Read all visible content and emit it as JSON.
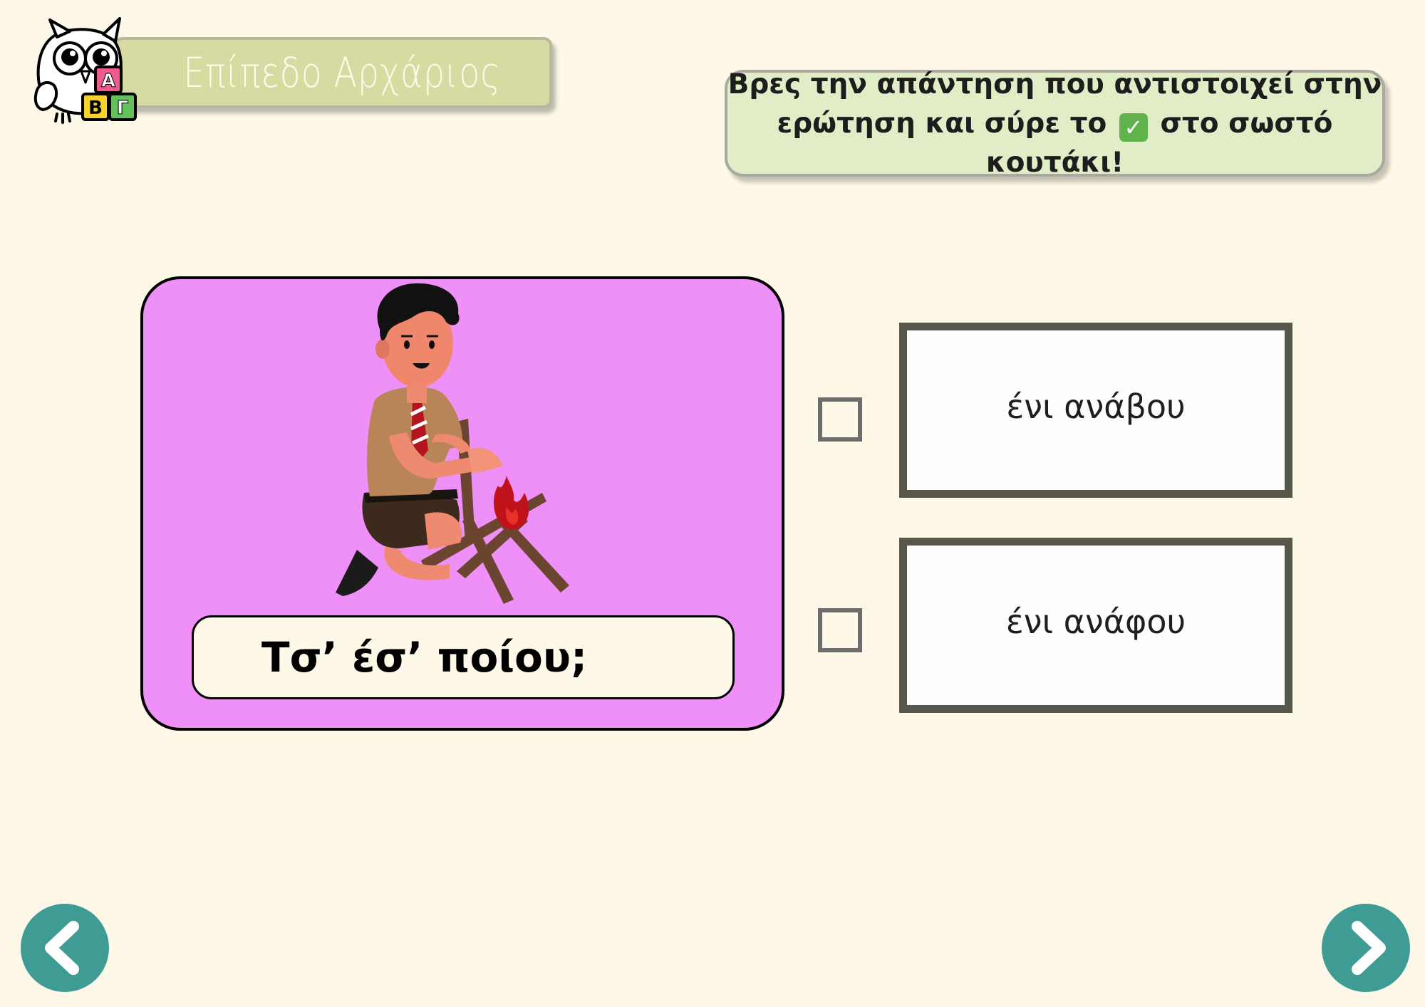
{
  "level": {
    "title": "Επίπεδο Αρχάριος",
    "logo_letters": [
      "Α",
      "Β",
      "Γ"
    ]
  },
  "instruction": {
    "line1": "Βρες την απάντηση που αντιστοιχεί στην",
    "line2_before": "ερώτηση και σύρε το",
    "check_glyph": "✓",
    "line2_after": "στο σωστό κουτάκι!"
  },
  "question": {
    "text": "Τσ’ έσ’ ποίου;"
  },
  "answers": [
    {
      "text": "ένι ανάβου",
      "checked": false
    },
    {
      "text": "ένι ανάφου",
      "checked": false
    }
  ],
  "nav": {
    "prev_icon": "chevron-left-icon",
    "next_icon": "chevron-right-icon"
  },
  "colors": {
    "background": "#fdf8e7",
    "card": "#ee90f8",
    "instruction_bg": "#e0edc6",
    "level_bg": "#d7daa1",
    "nav": "#3f9c94",
    "answer_border": "#56564a"
  }
}
